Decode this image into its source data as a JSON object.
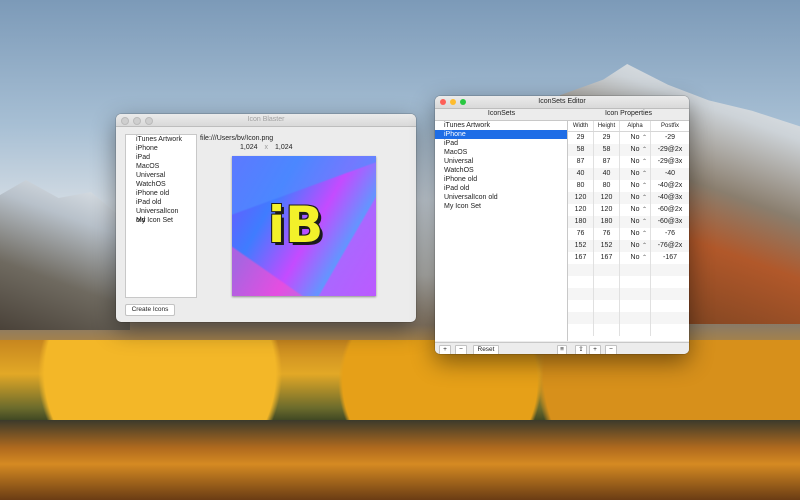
{
  "blaster": {
    "title": "Icon Blaster",
    "list": [
      "iTunes Artwork",
      "iPhone",
      "iPad",
      "MacOS",
      "Universal",
      "WatchOS",
      "iPhone old",
      "iPad old",
      "UniversalIcon old",
      "My Icon Set"
    ],
    "path": "file:///Users/bv/Icon.png",
    "width": "1,024",
    "times": "x",
    "height": "1,024",
    "logo_text": "iB",
    "create_label": "Create Icons"
  },
  "editor": {
    "title": "IconSets Editor",
    "iconsets_header": "IconSets",
    "props_header": "Icon Properties",
    "iconsets": [
      "iTunes Artwork",
      "iPhone",
      "iPad",
      "MacOS",
      "Universal",
      "WatchOS",
      "iPhone old",
      "iPad old",
      "UniversalIcon old",
      "My Icon Set"
    ],
    "selected": "iPhone",
    "columns": {
      "width": "Width",
      "height": "Height",
      "alpha": "Alpha",
      "postfix": "Postfix"
    },
    "rows": [
      {
        "w": "29",
        "h": "29",
        "a": "No",
        "p": "-29"
      },
      {
        "w": "58",
        "h": "58",
        "a": "No",
        "p": "-29@2x"
      },
      {
        "w": "87",
        "h": "87",
        "a": "No",
        "p": "-29@3x"
      },
      {
        "w": "40",
        "h": "40",
        "a": "No",
        "p": "-40"
      },
      {
        "w": "80",
        "h": "80",
        "a": "No",
        "p": "-40@2x"
      },
      {
        "w": "120",
        "h": "120",
        "a": "No",
        "p": "-40@3x"
      },
      {
        "w": "120",
        "h": "120",
        "a": "No",
        "p": "-60@2x"
      },
      {
        "w": "180",
        "h": "180",
        "a": "No",
        "p": "-60@3x"
      },
      {
        "w": "76",
        "h": "76",
        "a": "No",
        "p": "-76"
      },
      {
        "w": "152",
        "h": "152",
        "a": "No",
        "p": "-76@2x"
      },
      {
        "w": "167",
        "h": "167",
        "a": "No",
        "p": "-167"
      }
    ],
    "stepper_glyph": "⌃",
    "bottom": {
      "add": "+",
      "remove": "−",
      "reset": "Reset",
      "share": "⇪",
      "add2": "+",
      "remove2": "−",
      "grid": "≡"
    }
  }
}
